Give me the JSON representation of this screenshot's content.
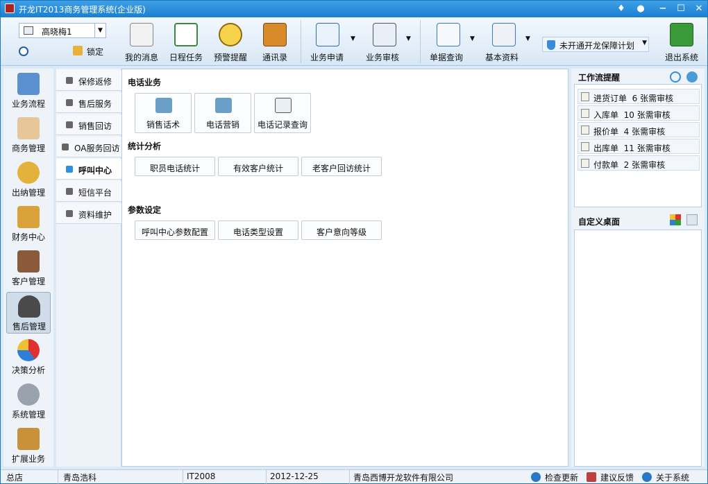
{
  "window": {
    "title": "开龙IT2013商务管理系统(企业版)",
    "controls": {
      "minimize": "−",
      "maximize": "☐",
      "close": "✕"
    }
  },
  "toolbar": {
    "user": "高晓梅1",
    "lock_label": "锁定",
    "tools": [
      {
        "label": "我的消息",
        "icon": "envelope-icon"
      },
      {
        "label": "日程任务",
        "icon": "calendar-icon"
      },
      {
        "label": "预警提醒",
        "icon": "alarm-clock-icon"
      },
      {
        "label": "通讯录",
        "icon": "address-book-icon"
      },
      {
        "label": "业务申请",
        "icon": "org-chart-icon"
      },
      {
        "label": "业务审核",
        "icon": "reviewer-icon"
      },
      {
        "label": "单据查询",
        "icon": "document-search-icon"
      },
      {
        "label": "基本资料",
        "icon": "notebook-search-icon"
      }
    ],
    "plan_label": "未开通开龙保障计划",
    "exit_label": "退出系统"
  },
  "leftnav": {
    "items": [
      {
        "label": "业务流程",
        "icon": "truck-icon"
      },
      {
        "label": "商务管理",
        "icon": "book-icon"
      },
      {
        "label": "出纳管理",
        "icon": "coins-icon"
      },
      {
        "label": "财务中心",
        "icon": "scales-icon"
      },
      {
        "label": "客户管理",
        "icon": "people-icon"
      },
      {
        "label": "售后管理",
        "icon": "headset-icon"
      },
      {
        "label": "决策分析",
        "icon": "pie-chart-icon"
      },
      {
        "label": "系统管理",
        "icon": "gears-icon"
      },
      {
        "label": "扩展业务",
        "icon": "package-icon"
      }
    ],
    "active": "售后管理"
  },
  "subnav": {
    "items": [
      "保修返修",
      "售后服务",
      "销售回访",
      "OA服务回访",
      "呼叫中心",
      "短信平台",
      "资料维护"
    ],
    "active": "呼叫中心"
  },
  "main": {
    "phone": {
      "title": "电话业务",
      "buttons": [
        "销售话术",
        "电话营销",
        "电话记录查询"
      ]
    },
    "stats": {
      "title": "统计分析",
      "buttons": [
        "职员电话统计",
        "有效客户统计",
        "老客户回访统计"
      ]
    },
    "params": {
      "title": "参数设定",
      "buttons": [
        "呼叫中心参数配置",
        "电话类型设置",
        "客户意向等级"
      ]
    }
  },
  "rightpanel": {
    "workflow_title": "工作流提醒",
    "workflow_items": [
      "进货订单  6 张需审核",
      "入库单  10 张需审核",
      "报价单  4 张需审核",
      "出库单  11 张需审核",
      "付款单  2 张需审核"
    ],
    "desktop_title": "自定义桌面"
  },
  "statusbar": {
    "branch": "总店",
    "company_user": "青岛浩科",
    "version": "IT2008",
    "date": "2012-12-25",
    "vendor": "青岛西博开龙软件有限公司",
    "check_update": "检查更新",
    "feedback": "建议反馈",
    "about": "关于系统"
  },
  "colors": {
    "titlebar": "#1b7fd0",
    "accent": "#2c8fe0"
  }
}
